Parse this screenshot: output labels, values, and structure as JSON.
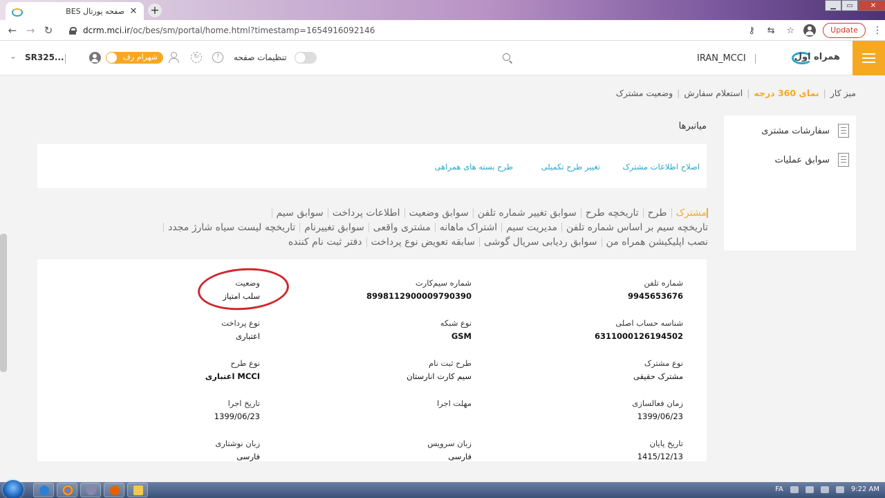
{
  "browser": {
    "tab_title": "صفحه پورتال BES",
    "url_host": "dcrm.mci.ir",
    "url_path": "/oc/bes/sm/portal/home.html?timestamp=1654916092146",
    "update_label": "Update",
    "icons": [
      "back-icon",
      "forward-icon",
      "reload-icon",
      "key-icon",
      "translate-icon",
      "star-icon",
      "profile-icon"
    ]
  },
  "header": {
    "brand": "IRAN_MCCI",
    "logo_text": "همراه اول",
    "page_settings_label": "تنظیمات صفحه",
    "user_name": "شهرام رف",
    "account_label": "SR325...",
    "accent_color": "#f7a823"
  },
  "breadcrumb": [
    "میز کار",
    "نمای 360 درجه",
    "استعلام سفارش",
    "وضعیت مشترک"
  ],
  "sidebar": {
    "items": [
      {
        "label": "سفارشات مشتری"
      },
      {
        "label": "سوابق عملیات"
      }
    ]
  },
  "shortcuts": {
    "title": "میانبرها",
    "links": [
      "اصلاح اطلاعات مشترک",
      "تغییر طرح تکمیلی",
      "طرح بسته های همراهی"
    ]
  },
  "subtabs": {
    "row1": [
      "مشترک",
      "طرح",
      "تاریخچه طرح",
      "سوابق تغییر شماره تلفن",
      "سوابق وضعیت",
      "اطلاعات پرداخت",
      "سوابق سیم"
    ],
    "row2": [
      "تاریخچه سیم بر اساس شماره تلفن",
      "مدیریت سیم",
      "اشتراک ماهانه",
      "مشتری واقعی",
      "سوابق تغییرنام",
      "تاریخچه لیست سیاه شارژ مجدد"
    ],
    "row3": [
      "نصب اپلیکیشن همراه من",
      "سوابق ردیابی سریال گوشی",
      "سابقه تعویض نوع پرداخت",
      "دفتر ثبت نام کننده"
    ]
  },
  "details": {
    "phone_number": {
      "label": "شماره تلفن",
      "value": "9945653676"
    },
    "sim_number": {
      "label": "شماره سیم‌کارت",
      "value": "8998112900009790390"
    },
    "status": {
      "label": "وضعیت",
      "value": "سلب امتیاز"
    },
    "main_account": {
      "label": "شناسه حساب اصلی",
      "value": "6311000126194502"
    },
    "network_type": {
      "label": "نوع شبکه",
      "value": "GSM"
    },
    "payment_type": {
      "label": "نوع پرداخت",
      "value": "اعتباری"
    },
    "subscriber_type": {
      "label": "نوع مشترک",
      "value": "مشترک حقیقی"
    },
    "registration_plan": {
      "label": "طرح ثبت نام",
      "value": "سیم کارت انارستان"
    },
    "plan_type": {
      "label": "نوع طرح",
      "value": "MCCI اعتباری"
    },
    "activation_time": {
      "label": "زمان فعالسازی",
      "value": "1399/06/23"
    },
    "execution_deadline": {
      "label": "مهلت اجرا",
      "value": ""
    },
    "execution_date": {
      "label": "تاریخ اجرا",
      "value": "1399/06/23"
    },
    "end_date": {
      "label": "تاریخ پایان",
      "value": "1415/12/13"
    },
    "service_language": {
      "label": "زبان سرویس",
      "value": "فارسی"
    },
    "written_language": {
      "label": "زبان نوشتاری",
      "value": "فارسی"
    }
  },
  "taskbar": {
    "lang": "FA",
    "time": "9:22 AM"
  }
}
